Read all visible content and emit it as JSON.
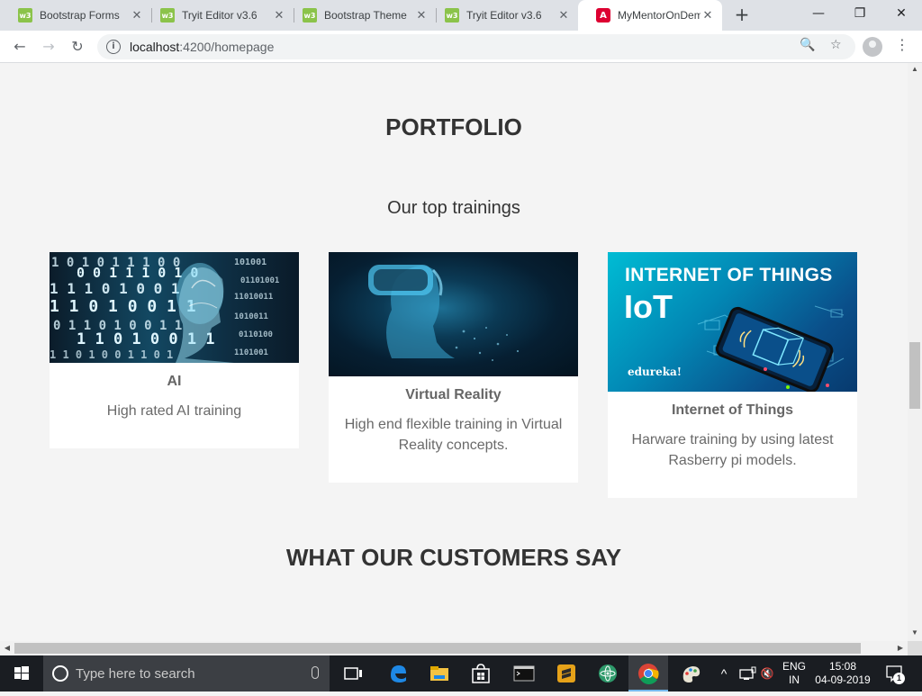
{
  "browser": {
    "tabs": [
      {
        "title": "Bootstrap Forms",
        "favicon": "w3",
        "active": false
      },
      {
        "title": "Tryit Editor v3.6",
        "favicon": "w3",
        "active": false
      },
      {
        "title": "Bootstrap Theme",
        "favicon": "w3",
        "active": false
      },
      {
        "title": "Tryit Editor v3.6",
        "favicon": "w3",
        "active": false
      },
      {
        "title": "MyMentorOnDem",
        "favicon": "A",
        "active": true
      }
    ],
    "close_glyph": "✕",
    "new_tab_glyph": "+",
    "window_controls": {
      "minimize": "—",
      "restore": "❐",
      "close": "✕"
    },
    "nav": {
      "back": "←",
      "forward": "→",
      "reload": "↻"
    },
    "url": {
      "host": "localhost",
      "path": ":4200/homepage"
    },
    "omnibox_icons": {
      "info": "i",
      "zoom": "🔍",
      "star": "☆"
    },
    "menu_glyph": "⋮"
  },
  "page": {
    "section_title": "PORTFOLIO",
    "subtitle": "Our top trainings",
    "cards": [
      {
        "title": "AI",
        "description": "High rated AI training",
        "image": "ai-binary-head"
      },
      {
        "title": "Virtual Reality",
        "description": "High end flexible training in Virtual Reality concepts.",
        "image": "vr-headset"
      },
      {
        "title": "Internet of Things",
        "description": "Harware training by using latest Rasberry pi models.",
        "image": "iot-banner",
        "image_text": {
          "headline": "INTERNET OF THINGS",
          "acronym": "IoT",
          "brand": "edureka!"
        }
      }
    ],
    "testimonials_title": "WHAT OUR CUSTOMERS SAY"
  },
  "scroll_arrows": {
    "up": "▲",
    "down": "▼",
    "left": "◀",
    "right": "▶"
  },
  "taskbar": {
    "search_placeholder": "Type here to search",
    "language": {
      "line1": "ENG",
      "line2": "IN"
    },
    "clock": {
      "time": "15:08",
      "date": "04-09-2019"
    },
    "notification_count": "1",
    "tray_glyphs": {
      "chevron": "^",
      "volume": "🔇"
    }
  },
  "colors": {
    "page_bg": "#f4f4f4",
    "card_bg": "#ffffff",
    "heading": "#333333",
    "taskbar": "#1a1d22",
    "angular_red": "#dd0031",
    "w3_green": "#8bc34a"
  }
}
